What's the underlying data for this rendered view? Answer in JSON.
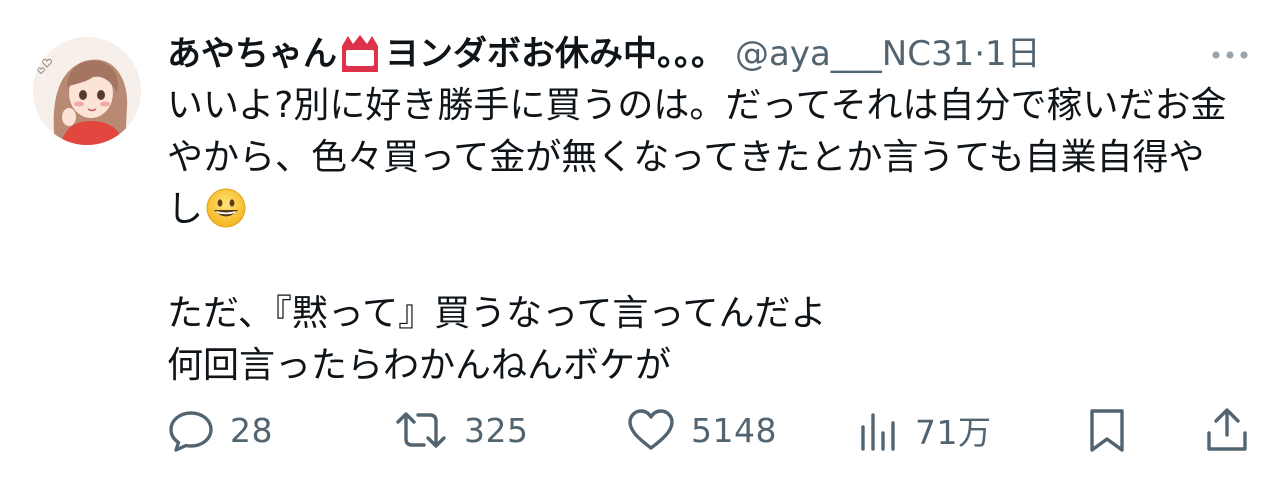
{
  "tweet": {
    "author": {
      "display_name_before_badge": "あやちゃん",
      "badge_icon": "name-badge-emoji",
      "display_name_after_badge": "ヨンダボお休み中。。。",
      "handle": "@aya___NC31",
      "separator": "·",
      "time": "1日"
    },
    "text": {
      "para1_line1": "いいよ?別に好き勝手に買うのは。だってそれは自分で稼いだお金",
      "para1_line2": "やから、色々買って金が無くなってきたとか言うても自業自得や",
      "para1_line3": "し",
      "para1_emoji": "grinning-face-emoji",
      "para2_line1": "ただ、『黙って』買うなって言ってんだよ",
      "para2_line2": "何回言ったらわかんねんボケが"
    },
    "actions": {
      "replies": "28",
      "retweets": "325",
      "likes": "5148",
      "views": "71万"
    }
  },
  "colors": {
    "text_primary": "#0f1419",
    "text_secondary": "#536471",
    "badge_red": "#e0314b"
  }
}
